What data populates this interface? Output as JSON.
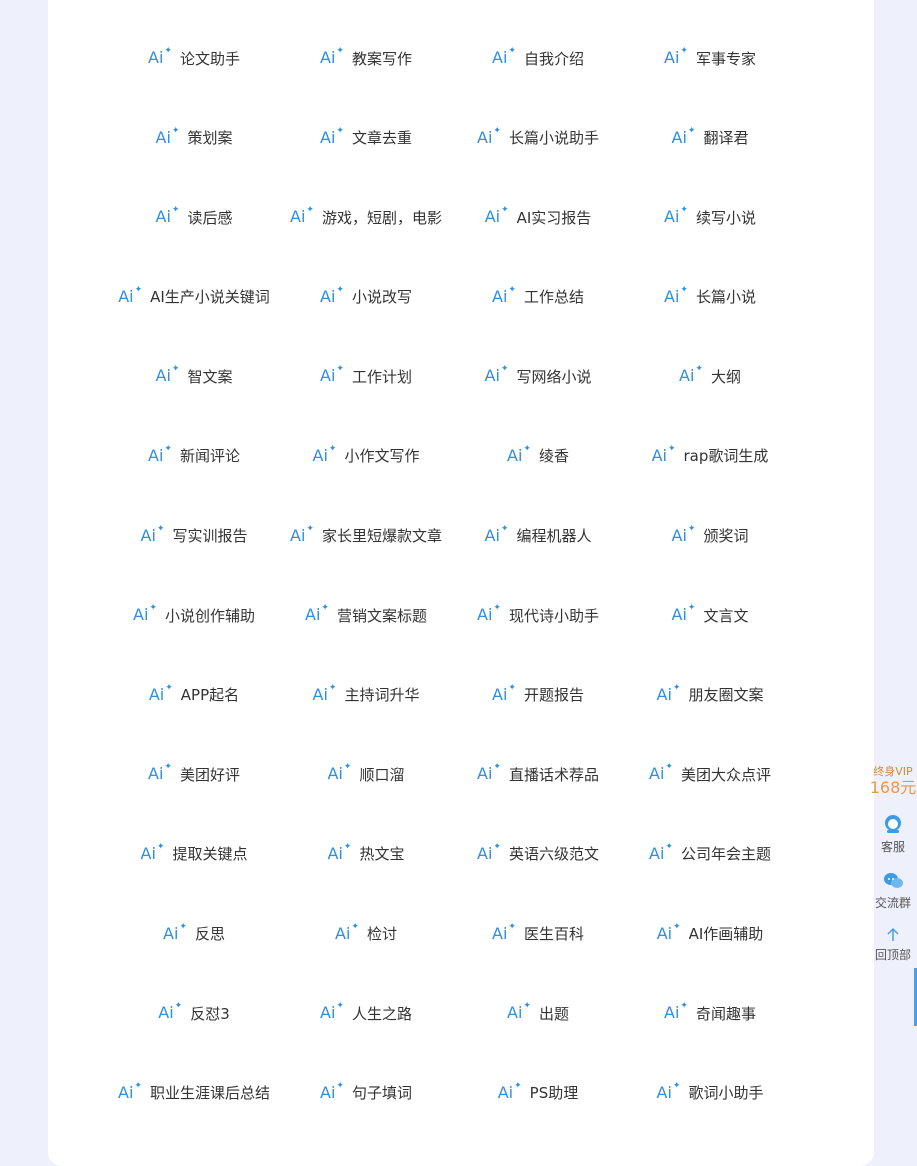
{
  "tools": [
    "论文助手",
    "教案写作",
    "自我介绍",
    "军事专家",
    "策划案",
    "文章去重",
    "长篇小说助手",
    "翻译君",
    "读后感",
    "游戏，短剧，电影",
    "AI实习报告",
    "续写小说",
    "AI生产小说关键词",
    "小说改写",
    "工作总结",
    "长篇小说",
    "智文案",
    "工作计划",
    "写网络小说",
    "大纲",
    "新闻评论",
    "小作文写作",
    "绫香",
    "rap歌词生成",
    "写实训报告",
    "家长里短爆款文章",
    "编程机器人",
    "颁奖词",
    "小说创作辅助",
    "营销文案标题",
    "现代诗小助手",
    "文言文",
    "APP起名",
    "主持词升华",
    "开题报告",
    "朋友圈文案",
    "美团好评",
    "顺口溜",
    "直播话术荐品",
    "美团大众点评",
    "提取关键点",
    "热文宝",
    "英语六级范文",
    "公司年会主题",
    "反思",
    "检讨",
    "医生百科",
    "AI作画辅助",
    "反怼3",
    "人生之路",
    "出题",
    "奇闻趣事",
    "职业生涯课后总结",
    "句子填词",
    "PS助理",
    "歌词小助手"
  ],
  "ai_badge": {
    "text": "Ai",
    "icon": "sparkle-icon",
    "color": "#2f8fe0"
  },
  "sidebar": {
    "vip_title": "终身VIP",
    "vip_price": "168元",
    "service_label": "客服",
    "group_label": "交流群",
    "top_label": "回顶部"
  }
}
